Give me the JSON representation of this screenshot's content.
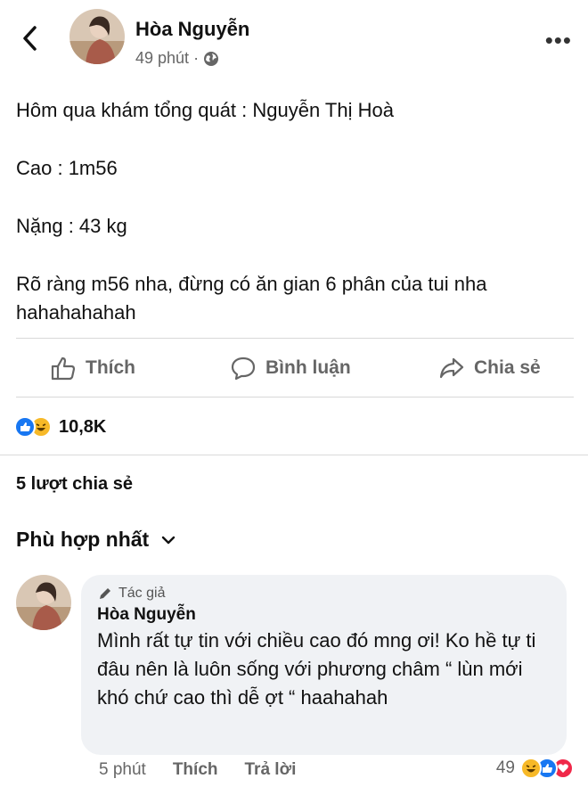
{
  "post": {
    "author": "Hòa Nguyễn",
    "time": "49 phút",
    "separator": "·",
    "privacy_icon": "globe-icon",
    "paragraphs": [
      "Hôm qua khám tổng quát : Nguyễn Thị Hoà",
      "Cao : 1m56",
      "Nặng : 43 kg",
      "Rõ ràng m56 nha, đừng có ăn gian 6 phân của tui nha hahahahahah"
    ]
  },
  "actions": {
    "like": "Thích",
    "comment": "Bình luận",
    "share": "Chia sẻ"
  },
  "reactions": {
    "types": [
      "like",
      "haha"
    ],
    "count": "10,8K"
  },
  "shares": "5 lượt chia sẻ",
  "sort": {
    "label": "Phù hợp nhất"
  },
  "comment": {
    "badge": "Tác giả",
    "author": "Hòa Nguyễn",
    "text": "Mình rất tự tin với chiều cao đó mng ơi! Ko hề tự ti đâu nên là luôn sống với phương châm “ lùn mới khó chứ cao thì dễ ợt “ haahahah",
    "time": "5 phút",
    "like": "Thích",
    "reply": "Trả lời",
    "reaction_count": "49",
    "reaction_types": [
      "haha",
      "like",
      "love"
    ]
  },
  "colors": {
    "like_blue": "#1877f2",
    "haha_yellow": "#f7b928",
    "love_red": "#f02849",
    "muted": "#666666"
  }
}
